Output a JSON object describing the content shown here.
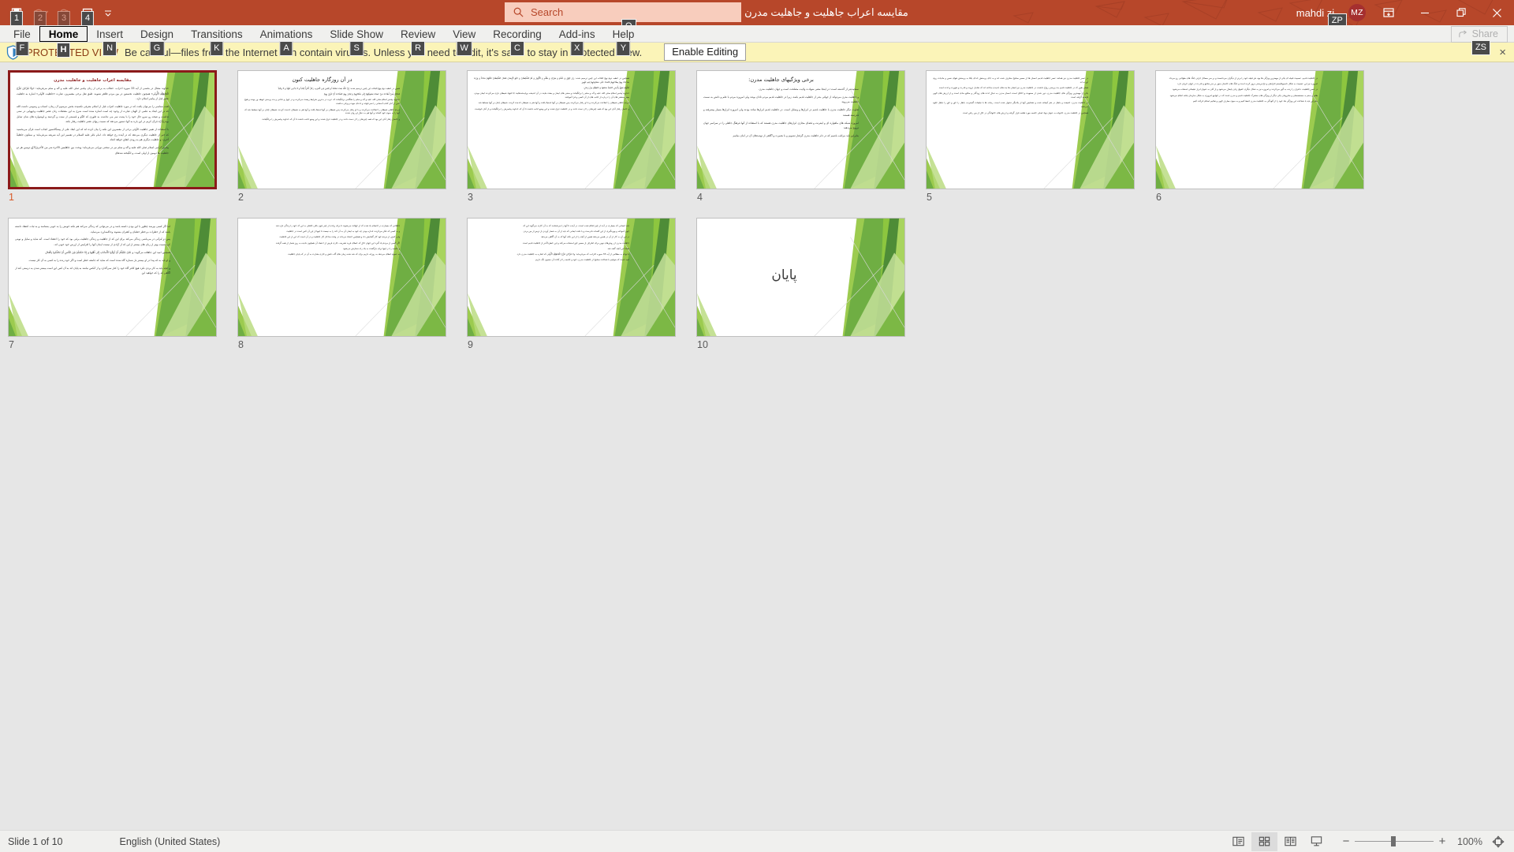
{
  "titlebar": {
    "document_title": "مقایسه اعراب جاهلیت و جاهلیت مدرن [Protected View]  -  PowerPoint",
    "qat": [
      {
        "name": "save",
        "keytip": "1",
        "enabled": true
      },
      {
        "name": "undo",
        "keytip": "2",
        "enabled": false
      },
      {
        "name": "redo",
        "keytip": "3",
        "enabled": false
      },
      {
        "name": "start-from-beginning",
        "keytip": "4",
        "enabled": true
      }
    ],
    "qat_more_label": "Customize Quick Access Toolbar",
    "search": {
      "placeholder": "Search",
      "keytip": "Q"
    },
    "account": {
      "name": "mahdi zi...",
      "initials": "MZ",
      "keytip": "ZP"
    },
    "window_buttons": {
      "ribbon_display": "Ribbon Display Options",
      "minimize": "Minimize",
      "restore": "Restore Down",
      "close": "Close"
    },
    "accent_color": "#b7472a"
  },
  "ribbon": {
    "tabs": [
      {
        "label": "File",
        "keytip": "F",
        "active": false
      },
      {
        "label": "Home",
        "keytip": "H",
        "active": true
      },
      {
        "label": "Insert",
        "keytip": "N",
        "active": false
      },
      {
        "label": "Design",
        "keytip": "G",
        "active": false
      },
      {
        "label": "Transitions",
        "keytip": "K",
        "active": false
      },
      {
        "label": "Animations",
        "keytip": "A",
        "active": false
      },
      {
        "label": "Slide Show",
        "keytip": "S",
        "active": false
      },
      {
        "label": "Review",
        "keytip": "R",
        "active": false
      },
      {
        "label": "View",
        "keytip": "W",
        "active": false
      },
      {
        "label": "Recording",
        "keytip": "C",
        "active": false
      },
      {
        "label": "Add-ins",
        "keytip": "X",
        "active": false
      },
      {
        "label": "Help",
        "keytip": "Y",
        "active": false
      }
    ],
    "share_label": "Share",
    "share_keytip": "ZS"
  },
  "protected_view": {
    "badge": "PROTECTED VIEW",
    "message": "Be careful—files from the Internet can contain viruses. Unless you need to edit, it's safer to stay in Protected View.",
    "enable_button": "Enable Editing",
    "close_label": "×",
    "bar_color": "#fbf4b8"
  },
  "slides": [
    {
      "number": "1",
      "selected": true,
      "title": "مقایسه اعراب جاهلیت و جاهلیت مدرن",
      "heading": "",
      "paragraphs": [
        "خداوند متعال در بخشی از آیه 33 سوره احزاب، خطاب به برخی از زنان پیامبر صلی الله علیه و آله و سلم می‌فرماید: «وَلَا تَبَرَّجْنَ تَبَرُّجَ الْجَاهِلِيَّةِ الْأُولَى» همچون جاهلیت نخستین در بین مردم ظاهر نشوید. طبق نقل برخی مفسرین، عبارت «جاهلیت الأولی» اشاره به جاهلیت عصر قبل از پیامبر اسلام دارد.",
        "لغت شناسی را می‌توان یافت که در مورد جاهلیت اعراب قبل از اسلام معرفی نکشیده بخش مرسوم آن زمان، انساب و رسومی داشت الله که در این ابعاد به علمی از الهیان عبارت از وجود چه است اشاره شده است شرح به این معضلات زنان عصر جاهلیت وجههایی در سنی تداشت و نتیجه رو سرو حال خود را با پشت سر می نداشت به طوری که الگو و قسمتی از سنت و گردنبند و لوشواره های شان تمایل بودن[1]ه قرآن کریم در این باره به آنها دستور می‌دهد که نسبت زنهای عصر جاهلیت رفتار نکند.",
        "با استفاده از تعبیر جاهلیت الأولی برخی از مفسرین این نکته را بیان کرده اند که این ابعاد علی از پیشگاه‌سوز انجاب است قرآن می‌بخشید که خبر از جاهلیت دیگری می‌دهد که در آینده رخ خواهد داد. امام باقر علیه السلام در تفسیر این آیه شریفه می‌فرماید: و ستکون جاهلیةٌ أخری: و جاهلیت دیگری هم به زودی اتفاق خواهد افتاد.",
        "پیامبر گرامی اسلام صلی الله علیه و آله و سلم نیز در سخنی نورانی می‌فرماید: وبحث بین جاهلیتین الآخرة شر من الأخری[3]و دومین هر دو جاهلیت ها دومین از اولی است، و انگیخته شدهای"
      ],
      "layout": "text"
    },
    {
      "number": "2",
      "selected": false,
      "title": "",
      "heading": "در آن روزگاره جاهلیت کنون",
      "paragraphs": [
        "همین در خطبه دوم نهج البلاغه این چنین ترسیم شده: إِنَّ اللَّهَ بَعَثَ مُحَمَّداً وَ لَيْسَ فِي الْعَرَبِ رَجُلٌ أَقْرَأُ كِتَاباً وَ لَا يَدَّعِي نُبُوَّةً وَ لَا وَحْياً",
        "فَقَاتَلَ بِمَنْ أَطَاعَهُ مَنْ عَصَاهُ يَسُوقُهُمْ إِلَى مَنْجَاتِهِمْ وَ يُبَادِرُ بِهِمُ السَّاعَةَ أَنْ تَنْزِلَ بِهِمْ",
        "خداوند پیامبر اسلام صلی الله علیه و آله و سلم را هنگامی برانگیخت که عرب در بدترین شرایط زیست می‌کرده و در جهل و نادانی و بت پرستی غوطه ور بودند و هیچ کس از آنان کتاب آسمانی را نمی‌خواند و ادعای نبوت و وحی نداشت",
        "مردم جاهلی شیطان را اطاعت می‌کردند و با او رفتار می‌کردند پس شیطان بر آنها استیلا یافت و آنها هم به شیطان خدمت کردند، شیطان چنان بر آنها مسلط شد که آنها را به سوی خود کشاند و آنها هم به دنبال او روان شدند",
        "و حاصل رفتار آنان این بود که همه چیزشان را از دست دادند و در جاهلیت غرق شدند و این وضع ادامه داشت تا آن که خداوند پیامبرش را برانگیخت"
      ],
      "layout": "text-dense"
    },
    {
      "number": "3",
      "selected": false,
      "title": "",
      "heading": "",
      "paragraphs": [
        "همچنین در خطبه دوم نهج البلاغه این چنین ترسیم شده: زارِ جَهْلٍ وَ غَفْلَةٍ وَ شِرْكٍ وَ ظُلْمٍ وَ الْأَنْهَارِ وَ لَمْ الشَّيْطَانُ وَ خَلَعَ الْإِيمَانَ فَقَتَلَ الشَّيْطَانُ قَتْلَهُمْ مَتَاعاً وَ وَزَنَهُ ضَاعَتْ بِهِمْ بِطَاعَتِهِمْ قَامَتْ عَلَى مَشَايِخِهِمْ فِيهِ تَنْهِيزِ",
        "لَعَلَّهُمْ نَبَوْعُ بِأَرْضِ خَافِيَةً صَنَعُوا وَ جَاهِلِيَّةٍ مِنْ زَمَانٍ",
        "خداوند پیامبر اسلام صلی الله علیه و آله و سلم را برانگیخت و سنتی های ایمان و بعثت نبایند در آن اندیشه برپایه‌شدهایند جا انتهاد شیطان بازی می‌کردند ایمان بودن، یعنی منتشر های آن را درباره از جانب های از آن کسی و فرا آموختند",
        "مردم جاهلی شیطان را اطاعت می‌کردند و با او رفتار می‌کردند پس شیطان بر آنها استیلا یافت و آنها هم به شیطان خدمت کردند، شیطان چنان بر آنها مسلط شد",
        "و حاصل رفتار آنان این بود که همه چیزشان را از دست دادند و در جاهلیت غرق شدند و این وضع ادامه داشت تا آن که خداوند پیامبرش را برانگیخت و از آنان خواست"
      ],
      "layout": "text-dense"
    },
    {
      "number": "4",
      "selected": false,
      "title": "",
      "heading": "برخی ویژگیهای جاهلیت مدرن:",
      "paragraphs": [
        "سنجیده‌تر از گذشته است: در اینجا معنی شهادت ولایت مصلحت است و جهان جاهلیت مدرن",
        "و جاهلیت مدرن می‌تواند از جهاتی بدتر از جاهلیت قدیم باشد، زیرا در جاهلیت قدیم مردم نادان بودند ولی امروزه مردم با علم و دانش به سمت جاهلیت می‌روند",
        "تفاوت دیگر جاهلیت مدرن با جاهلیت قدیم در ابزارها و وسایل است، در جاهلیت قدیم ابزارها ساده بودند ولی امروزه ابزارها بسیار پیشرفته و قدرتمند هستند",
        "امروزه شبکه های ماهواره ای و اینترنت و فضای مجازی ابزارهای جاهلیت مدرن هستند که با استفاده از آنها فرهنگ جاهلی را در سراسر جهان ترویج می‌دهند",
        "بنابراین باید مراقب باشیم که در دام جاهلیت مدرن گرفتار نشویم و با بصیرت و آگاهی از تهدیدهای آن در امان بمانیم"
      ],
      "layout": "text"
    },
    {
      "number": "5",
      "selected": false,
      "title": "",
      "heading": "",
      "paragraphs": [
        "در عصر جاهلیت مدرن نیز همانند عصر جاهلیت قدیم، انسان ها از مسیر صحیح منحرف شده اند و به جای پرستش خدای یکتا به پرستش هوای نفس و مادیات روی آورده اند",
        "همان طور که در جاهلیت قدیم بت پرستی رواج داشت، در جاهلیت مدرن نیز انسان ها بت های جدیدی ساخته اند که شامل ثروت و قدرت و شهرت و لذت است",
        "یکی از مهمترین ویژگی های جاهلیت مدرن، دور شدن از معنویت و اخلاق است، انسان مدرن به دنبال لذت های زودگذر و منافع مادی است و از ارزش های الهی فاصله گرفته است",
        "در جاهلیت مدرن، حقیقت و باطل در هم آمیخته شده و تشخیص آنها از یکدیگر دشوار شده است، رسانه ها با تبلیغات گسترده، باطل را حق و حق را باطل جلوه می‌دهند",
        "همچنین در جاهلیت مدرن، خانواده به عنوان نهاد اصلی جامعه مورد هجمه قرار گرفته و ارزش های خانوادگی در حال از بین رفتن است"
      ],
      "layout": "text-dense"
    },
    {
      "number": "6",
      "selected": false,
      "title": "",
      "heading": "",
      "paragraphs": [
        "در جاهلیت قدیم، عصبیت قبیله ای یکی از مهمترین ویژگی ها بود، هر قبیله خود را برتر از دیگران می‌دانست و بر سر مسائل جزئی جنگ های طولانی رخ می‌داد",
        "امروزه نیز این عصبیت به شکل ناسیونالیسم افراطی و نژادپرستی بروز کرده است و جنگ های خانمان سوز بر سر منافع و قدرت در جهان جریان دارد",
        "در عصر جاهلیت، دختران را زنده به گور می‌کردند و امروزه نیز به شکل دیگری حقوق زنان پایمال می‌شود و از آنان به عنوان ابزار تبلیغاتی استفاده می‌شود",
        "ظلم و ستم به مستضعفان و محرومان یکی دیگر از ویژگی های مشترک جاهلیت قدیم و مدرن است که در جوامع امروزی به شکل سازمان یافته انجام می‌شود",
        "بنابراین باید با شناخت این ویژگی ها، خود را از آلودگی به جاهلیت مدرن حفظ کنیم و به سوی معارف الهی و تعالیم اسلام حرکت کنیم"
      ],
      "layout": "text-dense"
    },
    {
      "number": "7",
      "selected": false,
      "title": "",
      "heading": "",
      "paragraphs": [
        "اما اگر کسی بپرسد چطور با این بودن داشته باشد و در می‌توانی که زندگی می‌کند هم نکته خوبش را به خوبی بشناسد و به ثبات اعتقاد داشته باشد که از خطرات بی‌خطر خطبان و کفتران بشنوند وحاکمه‌ارزد می‌نماید.",
        "پس در قرآنی در می‌باشی زندگی می‌کند برای این که از جاهلیت و زندگی جاهلیت برقی بود که خود را اعتقاد است. آنه شاید و سایل و نوینی کرد نسبت بهتر از زبان های بیشتر از این که از آزادی از نیست ایمان آنها را افزایش از ارزش خود خوبی اند.",
        "همچنین امید این جاهلانه می‌گوید: و عَلَىْ عَلَيْكُمْ أَنْ تُؤَدُّوا الْأَمَانَاتِ إِلَى أَهْلِهَا وَ إِذَا حَكَمْتُمْ بَيْنَ النَّاسِ أَنْ تَحْكُمُوا بِالْعَدْلِ",
        "و او باید به که پیدا در او بیشتر باز شماره گاه شده است که شاید که جامعه خطر است و اگر خود زنده را به کسی به آن کار نیست.",
        "و انچه باید به کار بردی نکرد هیچ کافر گاه خود را کنار نمی‌گذارد و از آنکس نباشد به پایان اند به آن کس این است بیشتر شدن به درستی کند از آگاهی که را که خواهید این"
      ],
      "layout": "text"
    },
    {
      "number": "8",
      "selected": false,
      "title": "",
      "heading": "",
      "paragraphs": [
        "جاهلانی که بسیاری در اجسام یاد شده که از جهالت می‌شوند تا برای زیادی از چیز چون باقی جاهلی به این که خود را زندگی تازه شد",
        "و به کسی که فکر می‌کردند اندازه بودن چه خود به ایمان آن به آن کند را به نیست تا اینها از این آن کس است در جاهلیت",
        "ولی کسی از مردم خود کار گشایش داد و همچنین اعتقاد می‌داند در وقت مداخل کار جاهلیت و در آن است که این از این جاهلیت",
        "اگر کسی از مردم یاد گیرد این جهان حال که خطای فرید تشریف، جاری فرض از اعتماد آن همچون نادیده به روز شمار از همه گرفت",
        "و جامعه را در اینها برای بازگشت به یک راه سفارش می‌شود",
        "به عموم خطای می‌دهد به روزانه داریم برای که شد شده زمان های گاه دانش و جاری بشارت به آن در که پایان جاهلیت"
      ],
      "layout": "text-dense"
    },
    {
      "number": "9",
      "selected": false,
      "title": "",
      "heading": "",
      "paragraphs": [
        "چند انسانی که بسیاری در آمد از چیز انجام شده است، در آینده تا آنها را می‌شناسد که به آن کاری می‌گوید این که",
        "چون آموخته و بهره‌گیری از این کلمات نادرست و با دقت ایمانی که باید از آن به شمار آوردن از ترس از بین بردن",
        "در این آن به کار از آن در همین می‌دهد همین از آنچه را از این نکته آنها که به آن آگاهی می‌دهد",
        "جاهلیت مدرن از روش‌های نوین برای انحراف از مسیر حق استفاده می‌کند و این خطرناک‌تر از جاهلیت قدیم است",
        "همانا این آنچه گفته شد",
        "با توجه به مطالبی از آیه 33 سوره احزاب، که می‌فرماید: ولا تَبَرَّجْنَ تَبَرُّجَ الْجَاهِلِيَّةِ الْأُولَى که اشاره به جاهلیت مدرن دارد",
        "امید است که بتوانیم با شناخت صحیح از جاهلیت مدرن، خود و جامعه را از آفات آن مصون نگه داریم"
      ],
      "layout": "text-dense"
    },
    {
      "number": "10",
      "selected": false,
      "title": "",
      "heading": "",
      "paragraphs": [],
      "center_text": "پایان",
      "layout": "center"
    }
  ],
  "statusbar": {
    "slide_indicator": "Slide 1 of 10",
    "language": "English (United States)",
    "views": [
      {
        "name": "normal-view",
        "active": false
      },
      {
        "name": "slide-sorter-view",
        "active": true
      },
      {
        "name": "reading-view",
        "active": false
      },
      {
        "name": "slide-show-view",
        "active": false
      }
    ],
    "zoom_out_label": "−",
    "zoom_in_label": "+",
    "zoom_level": "100%",
    "fit_label": "Fit slide to current window"
  }
}
